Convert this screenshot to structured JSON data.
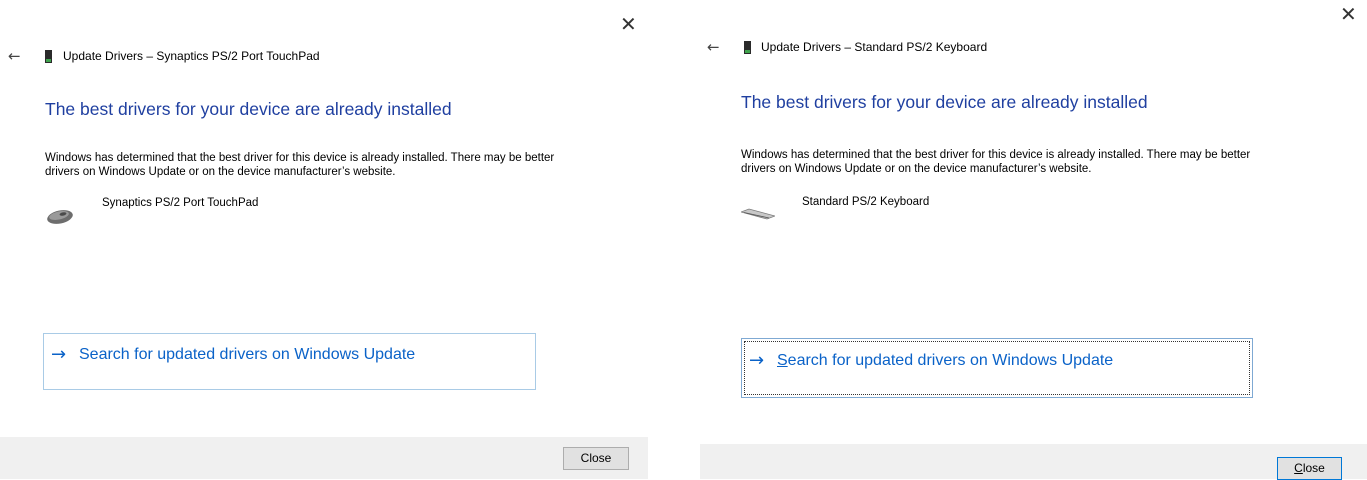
{
  "dialogs": [
    {
      "title": "Update Drivers – Synaptics PS/2 Port TouchPad",
      "heading": "The best drivers for your device are already installed",
      "description": "Windows has determined that the best driver for this device is already installed. There may be better drivers on Windows Update or on the device manufacturer’s website.",
      "device_name": "Synaptics PS/2 Port TouchPad",
      "device_icon": "touchpad-icon",
      "link_text": "Search for updated drivers on Windows Update",
      "close_button": "Close",
      "close_glyph": "✕",
      "back_glyph": "←",
      "link_arrow": "→"
    },
    {
      "title": "Update Drivers – Standard PS/2 Keyboard",
      "heading": "The best drivers for your device are already installed",
      "description": "Windows has determined that the best driver for this device is already installed. There may be better drivers on Windows Update or on the device manufacturer’s website.",
      "device_name": "Standard PS/2 Keyboard",
      "device_icon": "keyboard-icon",
      "link_text_first": "S",
      "link_text_rest": "earch for updated drivers on Windows Update",
      "close_button_first": "C",
      "close_button_rest": "lose",
      "close_glyph": "✕",
      "back_glyph": "←",
      "link_arrow": "→"
    }
  ],
  "colors": {
    "heading": "#1f3fa0",
    "link": "#0a62c8",
    "footer": "#f0f0f0",
    "link_border": "#a9cbe6"
  }
}
